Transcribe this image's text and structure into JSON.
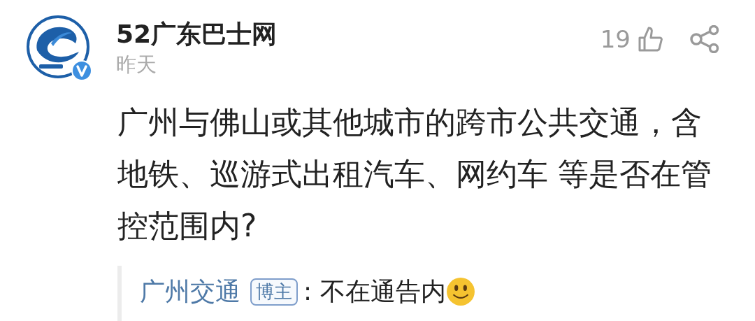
{
  "post": {
    "author": "52广东巴士网",
    "verified": true,
    "time": "昨天",
    "likes": "19",
    "body": "广州与佛山或其他城市的跨市公共交通，含地铁、巡游式出租汽车、网约车 等是否在管控范围内?"
  },
  "reply": {
    "author": "广州交通",
    "badge": "博主",
    "text": ": 不在通告内",
    "emoji": true
  }
}
